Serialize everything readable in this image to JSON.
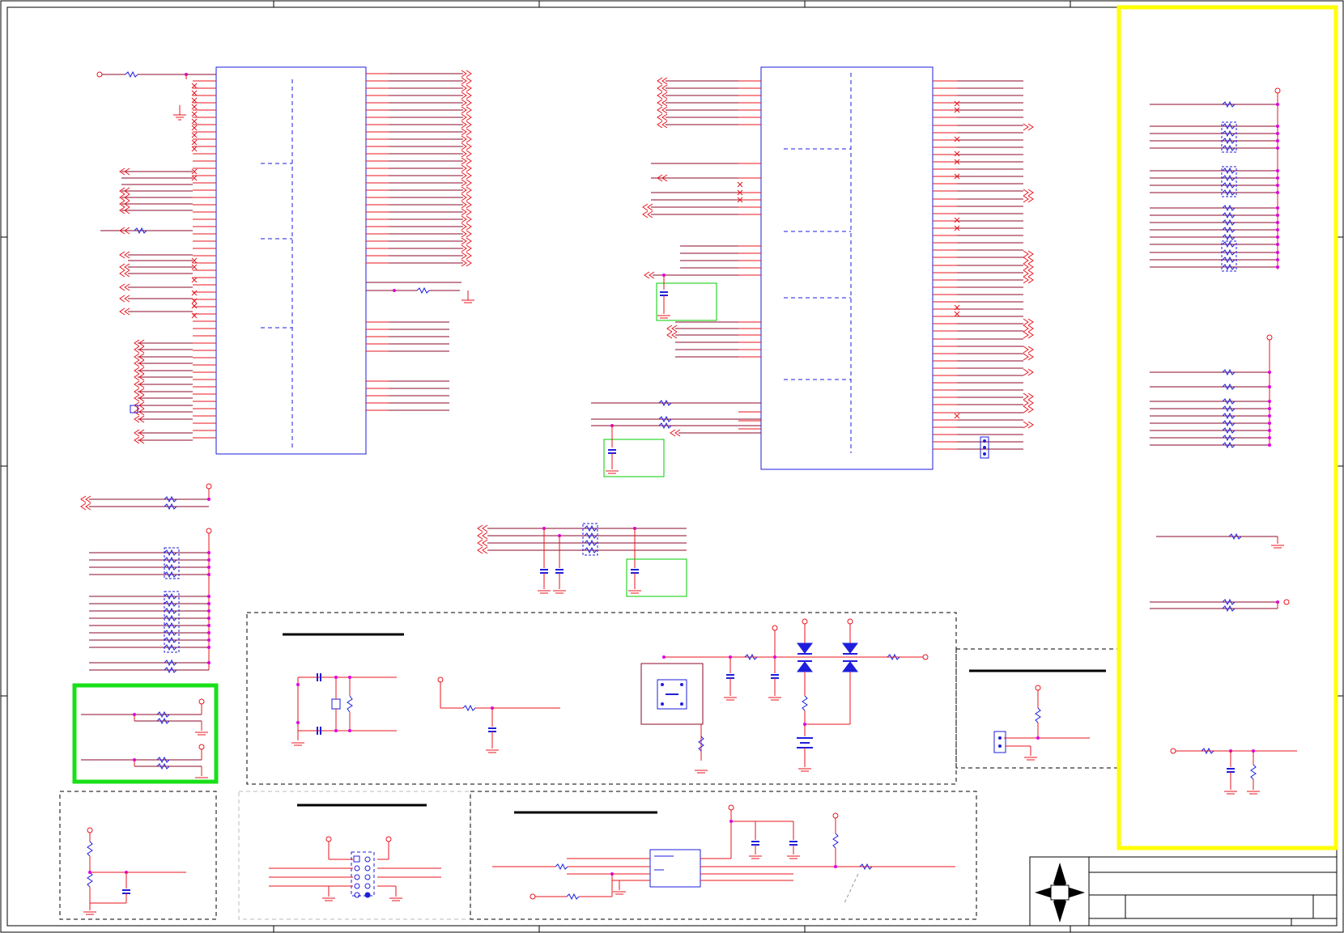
{
  "colors": {
    "background": "#ffffff",
    "frame": "#000000",
    "wire": "#e8141e",
    "bus": "#8b0a2a",
    "component": "#1e1edc",
    "junction": "#e000e0",
    "highlight_yellow": "#ffff00",
    "highlight_green": "#18e018",
    "note_box": "#00cc00",
    "title_block": "#000000"
  },
  "sheet": {
    "type": "schematic",
    "text_visible": false
  },
  "title_block": {
    "logo": "compass-star-logo"
  },
  "highlights": [
    {
      "name": "yellow-highlight-box",
      "color": "yellow"
    },
    {
      "name": "green-highlight-box",
      "color": "green"
    }
  ]
}
